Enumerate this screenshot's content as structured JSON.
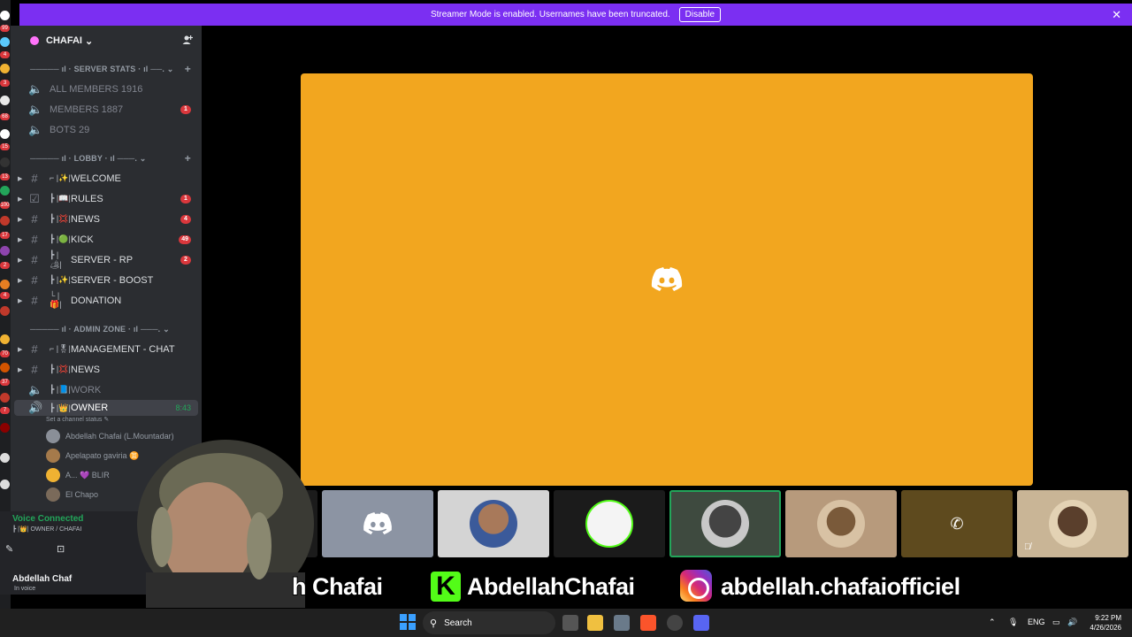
{
  "banner": {
    "text": "Streamer Mode is enabled. Usernames have been truncated.",
    "button": "Disable",
    "close": "✕"
  },
  "server": {
    "name": "CHAFAI",
    "chevron": "⌄",
    "invite_icon": "add-person-icon"
  },
  "categories": {
    "stats": "───── ıl · SERVER STATS · ıl ──. ⌄",
    "lobby": "───── ıl · LOBBY · ıl ───. ⌄",
    "admin": "───── ıl · ADMIN ZONE · ıl ───. ⌄",
    "plus": "+"
  },
  "stats_channels": [
    {
      "name": "ALL MEMBERS 1916",
      "badge": ""
    },
    {
      "name": "MEMBERS 1887",
      "badge": "1"
    },
    {
      "name": "BOTS 29",
      "badge": ""
    }
  ],
  "lobby_channels": [
    {
      "prefix": "⌐ |✨|",
      "name": "WELCOME",
      "badge": ""
    },
    {
      "prefix": "┣ |📖|",
      "name": "RULES",
      "badge": "1"
    },
    {
      "prefix": "┣ |💢|",
      "name": "NEWS",
      "badge": "4"
    },
    {
      "prefix": "┣ |🟢|",
      "name": "KICK",
      "badge": "49"
    },
    {
      "prefix": "┣ |🏕|",
      "name": "SERVER - RP",
      "badge": "2"
    },
    {
      "prefix": "┣ |✨|",
      "name": "SERVER - BOOST",
      "badge": ""
    },
    {
      "prefix": "└ |🎁|",
      "name": "DONATION",
      "badge": ""
    }
  ],
  "admin_channels": [
    {
      "prefix": "⌐ |🎖|",
      "name": "MANAGEMENT - CHAT",
      "badge": ""
    },
    {
      "prefix": "┣ |💢|",
      "name": "NEWS",
      "badge": ""
    },
    {
      "prefix": "┣ |📘|",
      "name": "WORK",
      "badge": ""
    }
  ],
  "owner_channel": {
    "prefix": "┣ |👑|",
    "name": "OWNER",
    "time": "8:43",
    "status": "Set a channel status ✎"
  },
  "voice_users": [
    {
      "name": "Abdellah Chafai (L.Mountadar)",
      "color": "#8a8f98"
    },
    {
      "name": "Apelapato gaviria ♊",
      "color": "#a57a4b"
    },
    {
      "name": "A... 💜 BLIR",
      "color": "#f0b232"
    },
    {
      "name": "El Chapo",
      "color": "#7a6a5a"
    }
  ],
  "voice_panel": {
    "status": "Voice Connected",
    "channel": "┣ |👑| OWNER / CHAFAI",
    "user": "Abdellah Chaf",
    "state": "In voice"
  },
  "social": {
    "kick_name": "h Chafai",
    "kick_handle": "AbdellahChafai",
    "kick_letter": "K",
    "insta_handle": "abdellah.chafaiofficiel"
  },
  "taskbar": {
    "search": "Search",
    "lang": "ENG",
    "time": "9:22 PM",
    "date": "4/26/2026"
  }
}
